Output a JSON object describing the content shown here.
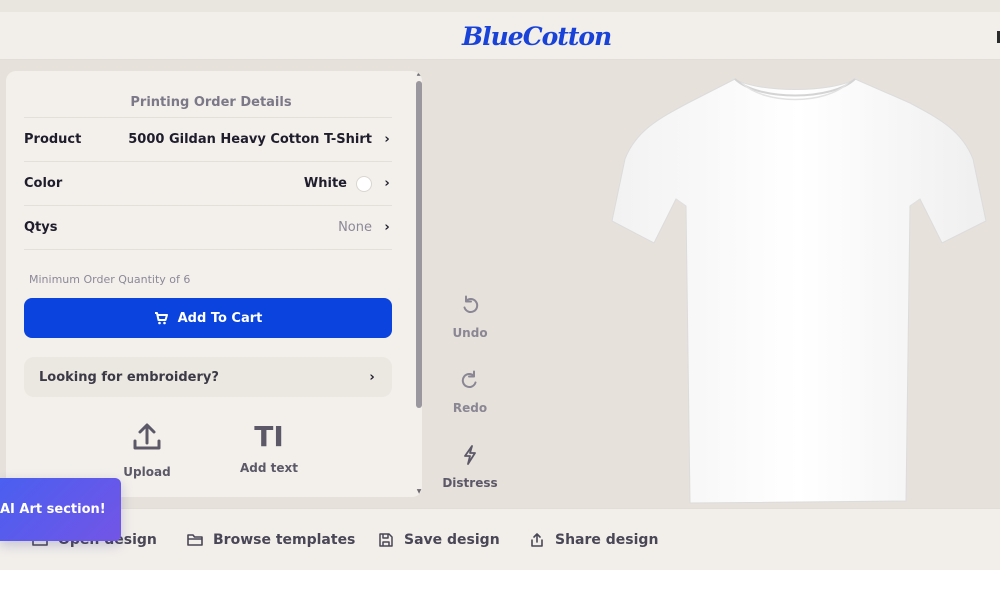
{
  "header": {
    "logo_text": "BlueCotton"
  },
  "order_panel": {
    "title": "Printing Order Details",
    "rows": [
      {
        "label": "Product",
        "value": "5000 Gildan Heavy Cotton T-Shirt"
      },
      {
        "label": "Color",
        "value": "White",
        "swatch_color": "#ffffff"
      },
      {
        "label": "Qtys",
        "value": "None"
      }
    ],
    "min_order_note": "Minimum Order Quantity of 6",
    "add_to_cart_label": "Add To Cart",
    "embroidery_label": "Looking for embroidery?",
    "tools": [
      {
        "label": "Upload",
        "icon": "upload-icon"
      },
      {
        "label": "Add text",
        "icon": "text-cursor-icon",
        "glyph": "TI"
      }
    ]
  },
  "canvas_tools": [
    {
      "label": "Undo",
      "icon": "undo-icon"
    },
    {
      "label": "Redo",
      "icon": "redo-icon"
    },
    {
      "label": "Distress",
      "icon": "lightning-icon"
    }
  ],
  "bottom_bar": {
    "items": [
      {
        "label": "Open design",
        "icon": "folder-open-icon"
      },
      {
        "label": "Browse templates",
        "icon": "folder-icon"
      },
      {
        "label": "Save design",
        "icon": "save-icon"
      },
      {
        "label": "Share design",
        "icon": "share-icon"
      }
    ]
  },
  "ai_banner": {
    "label": "AI Art section!"
  },
  "colors": {
    "brand_blue": "#0a43dd",
    "logo_blue": "#1842d8",
    "ai_gradient_start": "#4a5ff0",
    "ai_gradient_end": "#7355e6",
    "panel_bg": "#f3f0ec",
    "workspace_bg": "#e6e1db"
  }
}
